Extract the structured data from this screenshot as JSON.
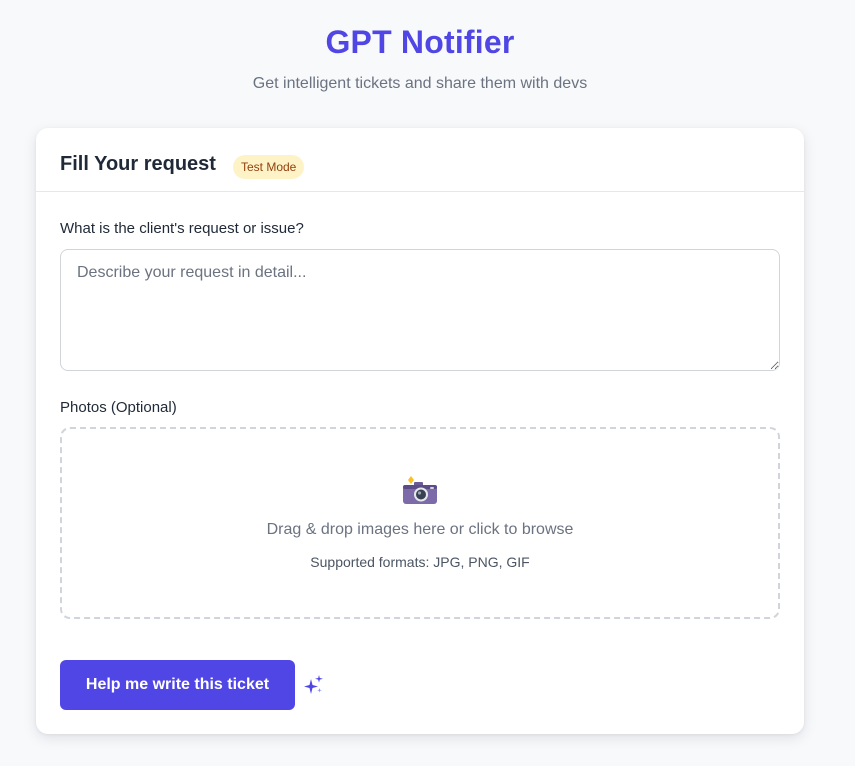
{
  "header": {
    "title": "GPT Notifier",
    "subtitle": "Get intelligent tickets and share them with devs"
  },
  "card": {
    "title": "Fill Your request",
    "badge": "Test Mode"
  },
  "request_field": {
    "label": "What is the client's request or issue?",
    "placeholder": "Describe your request in detail...",
    "value": ""
  },
  "photos_field": {
    "label": "Photos (Optional)",
    "icon": "camera-icon",
    "drop_text": "Drag & drop images here or click to browse",
    "formats_text": "Supported formats: JPG, PNG, GIF"
  },
  "actions": {
    "submit_label": "Help me write this ticket",
    "submit_icon": "sparkle-icon"
  },
  "colors": {
    "accent": "#4f46e5",
    "page_background": "#f8f9fb",
    "badge_background": "#fef3c7",
    "badge_text": "#92400e"
  }
}
